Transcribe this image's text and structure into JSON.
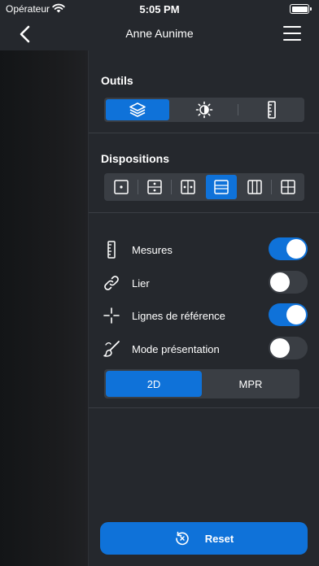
{
  "status_bar": {
    "carrier": "Opérateur",
    "time": "5:05 PM"
  },
  "nav": {
    "title": "Anne Aunime"
  },
  "outils": {
    "title": "Outils",
    "options": [
      {
        "icon": "layers-icon",
        "active": true
      },
      {
        "icon": "brightness-icon",
        "active": false
      },
      {
        "icon": "ruler-icon",
        "active": false
      }
    ]
  },
  "dispositions": {
    "title": "Dispositions",
    "options": [
      {
        "icon": "layout-single-icon",
        "active": false
      },
      {
        "icon": "layout-two-rows-dots-icon",
        "active": false
      },
      {
        "icon": "layout-two-columns-dots-icon",
        "active": false
      },
      {
        "icon": "layout-two-rows-icon",
        "active": true
      },
      {
        "icon": "layout-three-columns-icon",
        "active": false
      },
      {
        "icon": "layout-grid-icon",
        "active": false
      }
    ]
  },
  "settings": [
    {
      "label": "Mesures",
      "icon": "ruler-icon",
      "on": true
    },
    {
      "label": "Lier",
      "icon": "link-icon",
      "on": false
    },
    {
      "label": "Lignes de référence",
      "icon": "crosshair-icon",
      "on": true
    },
    {
      "label": "Mode présentation",
      "icon": "brush-icon",
      "on": false
    }
  ],
  "mode": {
    "options": [
      "2D",
      "MPR"
    ],
    "active": "2D"
  },
  "reset": {
    "label": "Reset"
  },
  "colors": {
    "accent": "#0f72d9",
    "panel": "#25282d",
    "control": "#3a3e44"
  }
}
